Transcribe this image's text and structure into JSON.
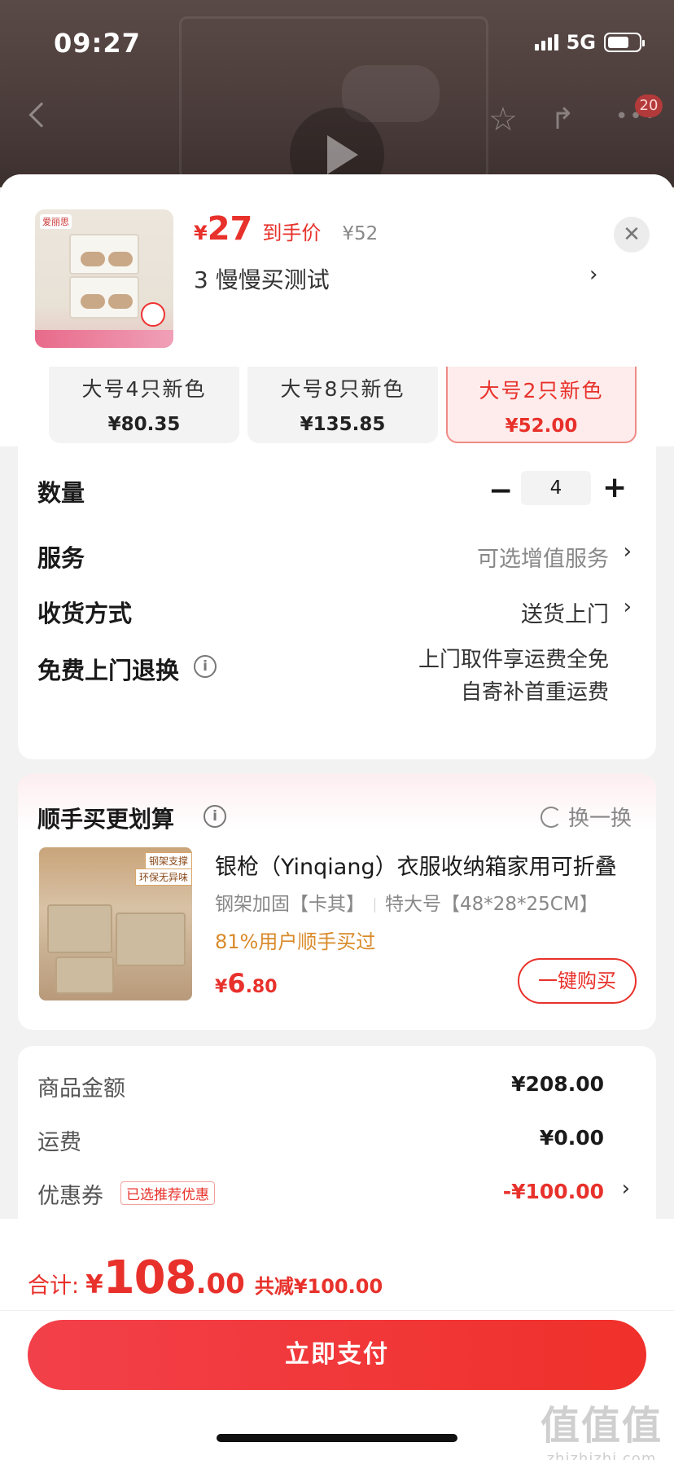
{
  "status_bar": {
    "time": "09:27",
    "network": "5G"
  },
  "top_nav": {
    "badge_count": "20"
  },
  "product": {
    "price_symbol": "¥",
    "price": "27",
    "price_tag": "到手价",
    "original_price": "¥52",
    "selected_spec": "3  慢慢买测试"
  },
  "spec_options": [
    {
      "name": "大号4只新色",
      "price": "¥80.35",
      "active": false
    },
    {
      "name": "大号8只新色",
      "price": "¥135.85",
      "active": false
    },
    {
      "name": "大号2只新色",
      "price": "¥52.00",
      "active": true
    }
  ],
  "order_options": {
    "quantity_label": "数量",
    "quantity_value": "4",
    "service_label": "服务",
    "service_value": "可选增值服务",
    "delivery_label": "收货方式",
    "delivery_value": "送货上门",
    "return_label": "免费上门退换",
    "return_line1": "上门取件享运费全免",
    "return_line2": "自寄补首重运费"
  },
  "addon": {
    "title": "顺手买更划算",
    "swap_label": "换一换",
    "name": "银枪（Yinqiang）衣服收纳箱家用可折叠",
    "spec1": "钢架加固【卡其】",
    "spec2": "特大号【48*28*25CM】",
    "bought_text": "81%用户顺手买过",
    "price_symbol": "¥",
    "price_int": "6",
    "price_dec": ".80",
    "buy_label": "一键购买",
    "img_tag1": "钢架支撑",
    "img_tag2": "环保无异味"
  },
  "summary": {
    "goods_label": "商品金额",
    "goods_value": "¥208.00",
    "shipping_label": "运费",
    "shipping_value": "¥0.00",
    "coupon_label": "优惠券",
    "coupon_badge": "已选推荐优惠",
    "coupon_value": "-¥100.00"
  },
  "footer": {
    "total_label": "合计:",
    "total_symbol": "¥",
    "total_int": "108",
    "total_dec": ".00",
    "saved": "共减¥100.00",
    "pay_label": "立即支付"
  },
  "watermark": {
    "main": "值值值",
    "sub": "zhizhizhi.com"
  },
  "colors": {
    "accent": "#e8312b",
    "addon_bought": "#d98a2a",
    "background": "#f2f2f2"
  }
}
